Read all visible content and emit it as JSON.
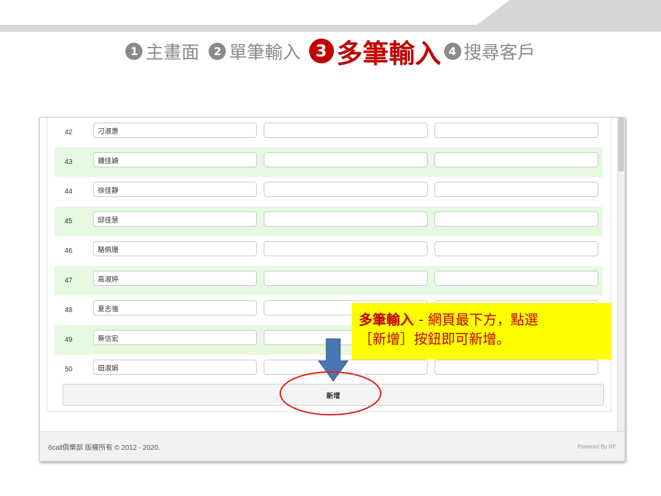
{
  "steps": [
    {
      "num": "1",
      "label": "主畫面"
    },
    {
      "num": "2",
      "label": "單筆輸入"
    },
    {
      "num": "3",
      "label": "多筆輸入"
    },
    {
      "num": "4",
      "label": "搜尋客戶"
    }
  ],
  "rows": [
    {
      "index": "42",
      "name": "刁淑惠"
    },
    {
      "index": "43",
      "name": "鍾佳穎"
    },
    {
      "index": "44",
      "name": "徐佳靜"
    },
    {
      "index": "45",
      "name": "邱佳慧"
    },
    {
      "index": "46",
      "name": "駱佩珊"
    },
    {
      "index": "47",
      "name": "高淑婷"
    },
    {
      "index": "48",
      "name": "夏志強"
    },
    {
      "index": "49",
      "name": "蔡信宏"
    },
    {
      "index": "50",
      "name": "田淑娟"
    }
  ],
  "add_button_label": "新增",
  "footer": {
    "copyright": "6call俱樂部 版權所有 © 2012 - 2020.",
    "powered_by": "Powered By RP"
  },
  "callout": {
    "highlight": "多筆輸入 ",
    "line1_rest": "- 網頁最下方，點選",
    "line2": "［新增］按鈕即可新增。"
  },
  "colors": {
    "accent": "#c00000",
    "step_gray": "#8a8a8a",
    "alt_row": "#e6f9e1",
    "callout_bg": "#ffff00",
    "arrow": "#4a77b4",
    "circle": "#e02020"
  }
}
